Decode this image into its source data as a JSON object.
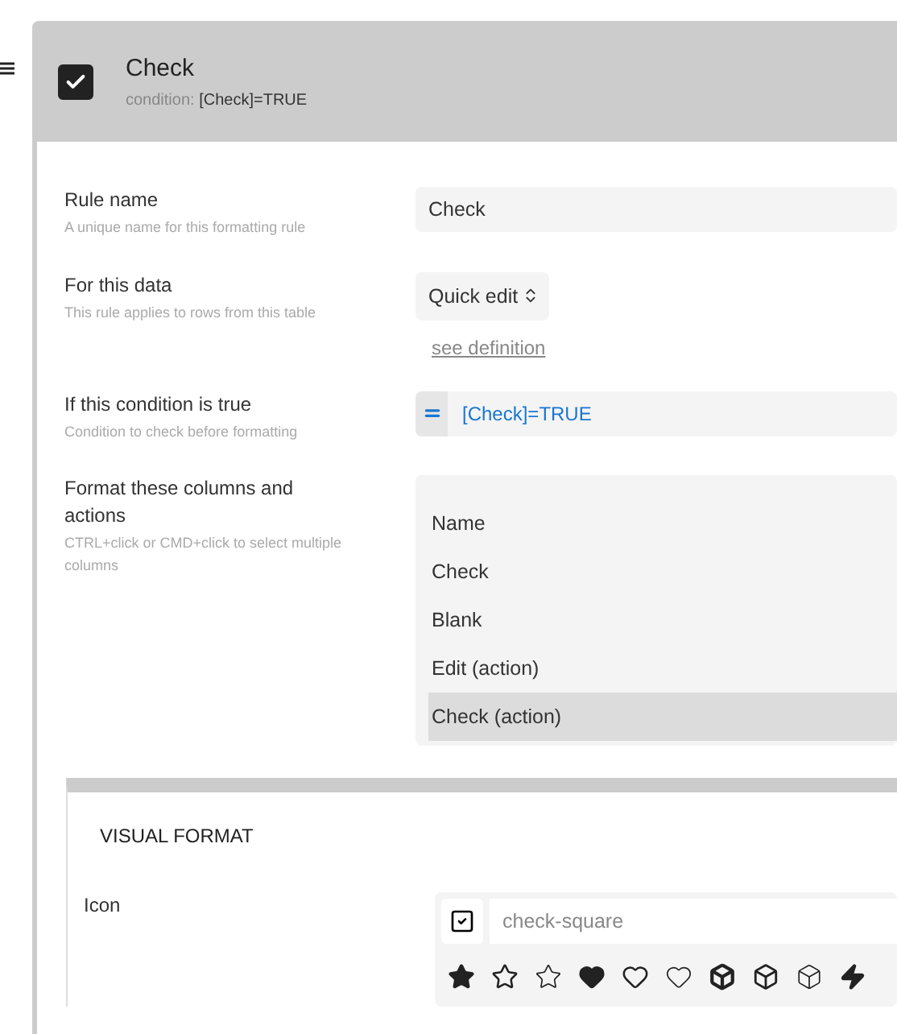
{
  "rule": {
    "title": "Check",
    "enabled": true,
    "condition_label": "condition:",
    "condition_value": "[Check]=TRUE"
  },
  "fields": [
    {
      "kind": "text",
      "label": "Rule name",
      "hint": "A unique name for this formatting rule",
      "value": "Check"
    },
    {
      "kind": "select",
      "label": "For this data",
      "hint": "This rule applies to rows from this table",
      "value": "Quick edit",
      "link": "see definition"
    },
    {
      "kind": "expression",
      "label": "If this condition is true",
      "hint": "Condition to check before formatting",
      "value": "[Check]=TRUE"
    },
    {
      "kind": "multiselect",
      "label": "Format these columns and actions",
      "hint": "CTRL+click or CMD+click to select multiple columns",
      "options": [
        {
          "label": "Name",
          "selected": false
        },
        {
          "label": "Check",
          "selected": false
        },
        {
          "label": "Blank",
          "selected": false
        },
        {
          "label": "Edit (action)",
          "selected": false
        },
        {
          "label": "Check (action)",
          "selected": true
        }
      ]
    }
  ],
  "visual_format": {
    "title": "VISUAL FORMAT",
    "icon_label": "Icon",
    "icon_value": "check-square"
  }
}
